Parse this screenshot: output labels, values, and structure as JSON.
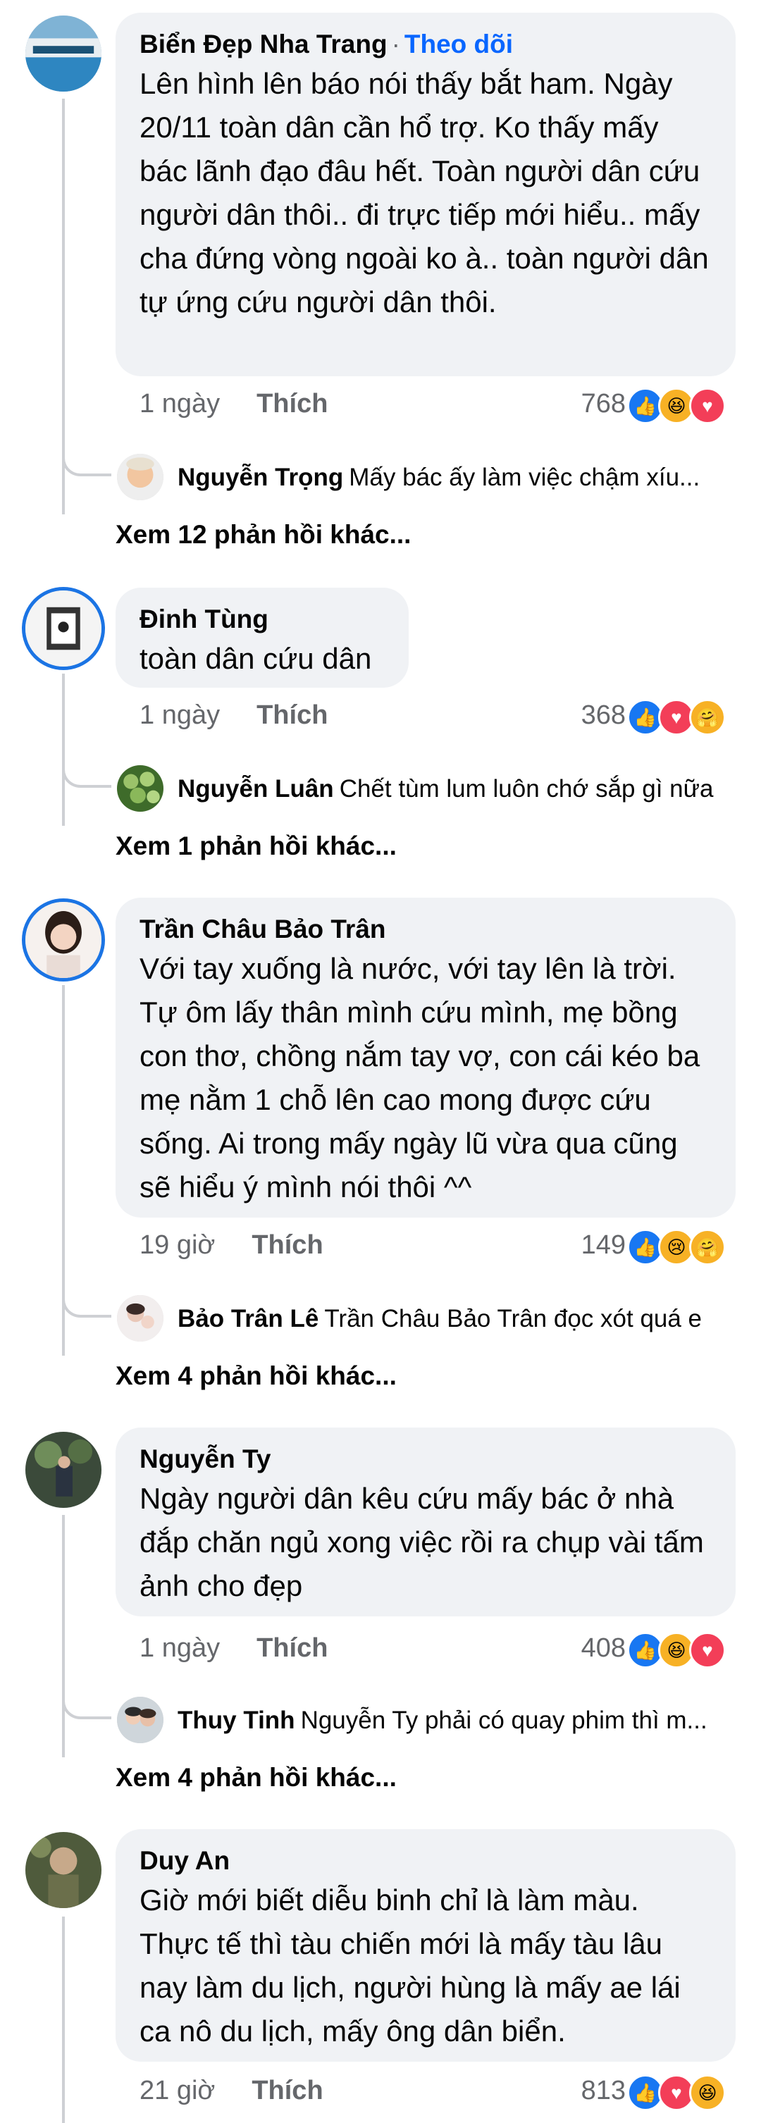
{
  "comments": [
    {
      "name": "Biển Đẹp Nha Trang",
      "follow": "Theo dõi",
      "text": "Lên hình lên báo nói thấy bắt ham. Ngày 20/11 toàn dân cần hổ trợ. Ko thấy mấy bác lãnh đạo đâu hết. Toàn người dân cứu người dân thôi.. đi trực tiếp mới hiểu.. mấy cha đứng vòng ngoài ko à.. toàn người dân tự ứng cứu người dân thôi.",
      "time": "1 ngày",
      "like": "Thích",
      "count": "768",
      "reactions": [
        "like",
        "haha",
        "love"
      ],
      "reply_name": "Nguyễn Trọng",
      "reply_text": "Mấy bác ấy làm việc chậm xíu...",
      "more": "Xem 12 phản hồi khác..."
    },
    {
      "name": "Đinh Tùng",
      "text": "toàn dân cứu dân",
      "time": "1 ngày",
      "like": "Thích",
      "count": "368",
      "reactions": [
        "like",
        "love",
        "care"
      ],
      "reply_name": "Nguyễn Luân",
      "reply_text": "Chết tùm lum luôn chớ sắp gì nữa",
      "more": "Xem 1 phản hồi khác..."
    },
    {
      "name": "Trần Châu Bảo Trân",
      "text": "Với tay xuống là nước, với tay lên là trời. Tự ôm lấy thân mình cứu mình, mẹ bồng con thơ, chồng nắm tay vợ, con cái kéo ba mẹ nằm 1 chỗ lên cao mong được cứu sống. Ai trong mấy ngày lũ vừa qua cũng sẽ hiểu ý mình nói thôi ^^",
      "time": "19 giờ",
      "like": "Thích",
      "count": "149",
      "reactions": [
        "like",
        "sad",
        "care"
      ],
      "reply_name": "Bảo Trân Lê",
      "reply_text": "Trần Châu Bảo Trân đọc xót quá e",
      "more": "Xem 4 phản hồi khác..."
    },
    {
      "name": "Nguyễn Ty",
      "text": "Ngày người dân kêu cứu mấy bác ở nhà đắp chăn ngủ xong việc rồi ra chụp vài tấm ảnh cho đẹp",
      "time": "1 ngày",
      "like": "Thích",
      "count": "408",
      "reactions": [
        "like",
        "haha",
        "love"
      ],
      "reply_name": "Thuy Tinh",
      "reply_text": "Nguyễn Ty phải có quay phim thì m...",
      "more": "Xem 4 phản hồi khác..."
    },
    {
      "name": "Duy An",
      "text": "Giờ mới biết diễu binh chỉ là làm màu. Thực tế thì tàu chiến mới là mấy tàu lâu nay làm du lịch, người hùng là mấy ae lái ca nô du lịch, mấy ông dân biển.",
      "time": "21 giờ",
      "like": "Thích",
      "count": "813",
      "reactions": [
        "like",
        "love",
        "haha"
      ]
    }
  ]
}
